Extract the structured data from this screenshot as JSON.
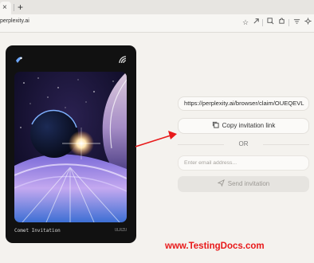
{
  "browser": {
    "tab_close": "×",
    "new_tab": "+",
    "url": "perplexity.ai",
    "icons": [
      "star-icon",
      "share-icon",
      "screenshot-icon",
      "extension-icon",
      "menu-icon",
      "settings-icon"
    ]
  },
  "card": {
    "title": "Comet Invitation",
    "code": "ULRZU"
  },
  "invite": {
    "link": "https://perplexity.ai/browser/claim/OUEQEVL",
    "copy_label": "Copy invitation link",
    "or_label": "OR",
    "email_placeholder": "Enter email address...",
    "send_label": "Send invitation"
  },
  "watermark": "www.TestingDocs.com",
  "colors": {
    "accent_arrow": "#e8191a",
    "card_bg": "#111111",
    "page_bg": "#f4f2ee"
  }
}
